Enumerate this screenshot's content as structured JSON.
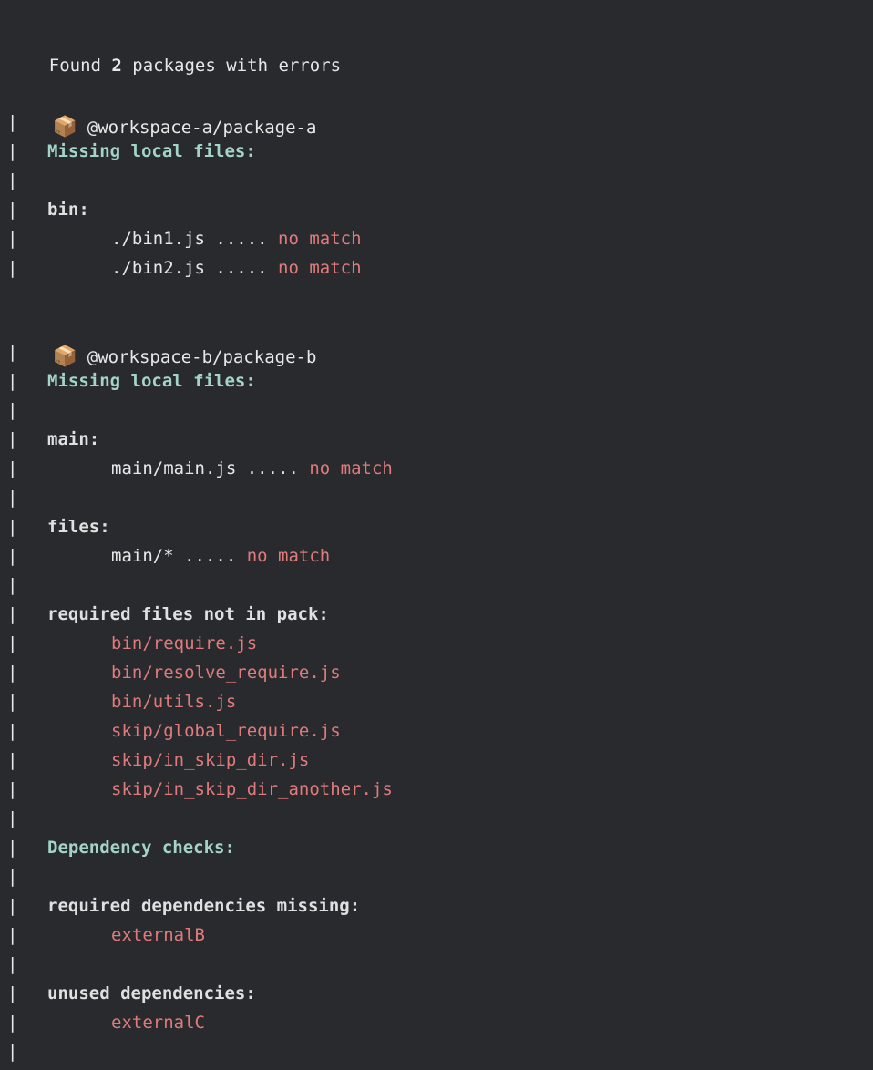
{
  "terminal": {
    "background": "#282a2e",
    "colors": {
      "text": "#e8e8e8",
      "error": "#e07b7b",
      "heading": "#a3d4c7"
    },
    "summary": {
      "prefix": "Found ",
      "count": "2",
      "suffix": " packages with errors"
    },
    "package_icon": "📦",
    "icon_name": "package-box-icon",
    "gutter_char": "|",
    "packages": [
      {
        "name": "@workspace-a/package-a",
        "sections": [
          {
            "type": "heading",
            "title": "Missing local files:",
            "groups": [
              {
                "label": "bin:",
                "entries": [
                  {
                    "path": "./bin1.js",
                    "dots": " ..... ",
                    "status": "no match"
                  },
                  {
                    "path": "./bin2.js",
                    "dots": " ..... ",
                    "status": "no match"
                  }
                ]
              }
            ]
          }
        ]
      },
      {
        "name": "@workspace-b/package-b",
        "sections": [
          {
            "type": "heading",
            "title": "Missing local files:",
            "groups": [
              {
                "label": "main:",
                "entries": [
                  {
                    "path": "main/main.js",
                    "dots": " ..... ",
                    "status": "no match"
                  }
                ]
              },
              {
                "label": "files:",
                "entries": [
                  {
                    "path": "main/*",
                    "dots": " ..... ",
                    "status": "no match"
                  }
                ]
              },
              {
                "label": "required files not in pack:",
                "items": [
                  "bin/require.js",
                  "bin/resolve_require.js",
                  "bin/utils.js",
                  "skip/global_require.js",
                  "skip/in_skip_dir.js",
                  "skip/in_skip_dir_another.js"
                ]
              }
            ]
          },
          {
            "type": "heading",
            "title": "Dependency checks:",
            "groups": [
              {
                "label": "required dependencies missing:",
                "items": [
                  "externalB"
                ]
              },
              {
                "label": "unused dependencies:",
                "items": [
                  "externalC"
                ]
              }
            ]
          }
        ]
      }
    ]
  }
}
